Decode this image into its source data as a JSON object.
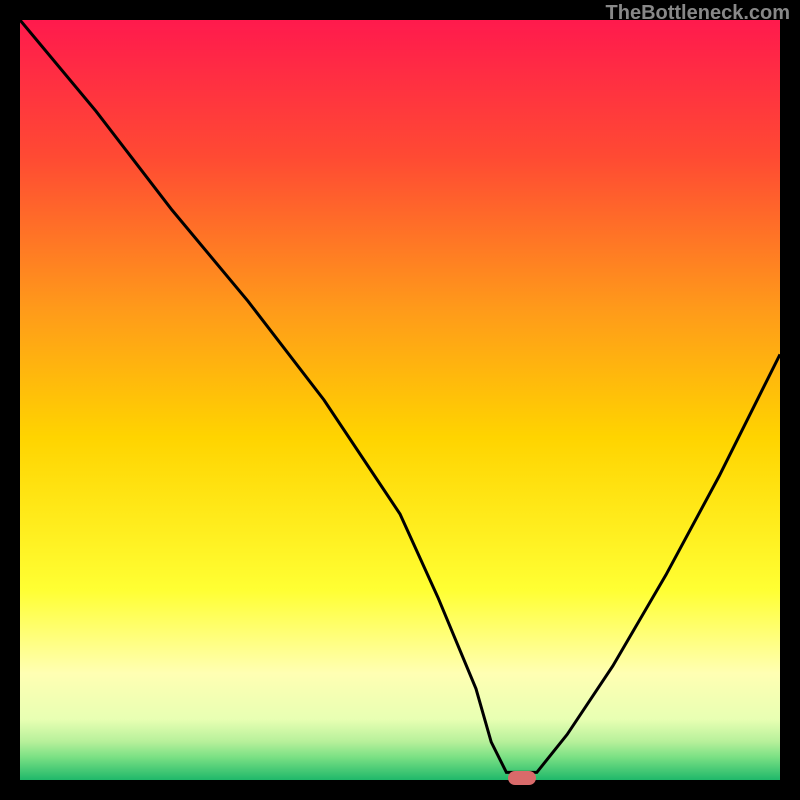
{
  "watermark": "TheBottleneck.com",
  "chart_data": {
    "type": "line",
    "title": "",
    "xlabel": "",
    "ylabel": "",
    "xlim": [
      0,
      100
    ],
    "ylim": [
      0,
      100
    ],
    "grid": false,
    "series": [
      {
        "name": "bottleneck-curve",
        "x": [
          0,
          10,
          20,
          30,
          40,
          50,
          55,
          60,
          62,
          64,
          68,
          72,
          78,
          85,
          92,
          100
        ],
        "values": [
          100,
          88,
          75,
          63,
          50,
          35,
          24,
          12,
          5,
          1,
          1,
          6,
          15,
          27,
          40,
          56
        ]
      }
    ],
    "marker": {
      "x": 66,
      "y": 0
    }
  },
  "gradient_colors": {
    "top": "#ff1a4d",
    "mid1": "#ff7a1a",
    "mid2": "#ffd400",
    "low": "#ffff8a",
    "green_light": "#c8f08f",
    "green": "#5fd67e",
    "green_deep": "#1fb86a"
  }
}
